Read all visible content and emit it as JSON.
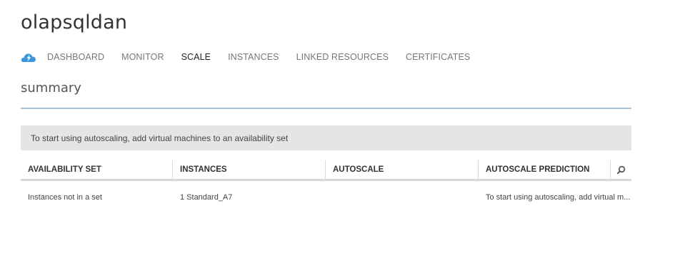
{
  "page": {
    "title": "olapsqldan"
  },
  "nav": {
    "icon": "cloud-service-icon",
    "accent_color": "#3a96dd",
    "tabs": [
      {
        "label": "DASHBOARD",
        "active": false
      },
      {
        "label": "MONITOR",
        "active": false
      },
      {
        "label": "SCALE",
        "active": true
      },
      {
        "label": "INSTANCES",
        "active": false
      },
      {
        "label": "LINKED RESOURCES",
        "active": false
      },
      {
        "label": "CERTIFICATES",
        "active": false
      }
    ]
  },
  "summary": {
    "heading": "summary",
    "rule_color": "#9cc7e4"
  },
  "notice": {
    "text": "To start using autoscaling, add virtual machines to an availability set"
  },
  "table": {
    "columns": [
      "AVAILABILITY SET",
      "INSTANCES",
      "AUTOSCALE",
      "AUTOSCALE PREDICTION"
    ],
    "search_icon": "search-icon",
    "rows": [
      {
        "availability_set": "Instances not in a set",
        "instances": "1 Standard_A7",
        "autoscale": "",
        "prediction": "To start using autoscaling, add virtual m..."
      }
    ]
  }
}
